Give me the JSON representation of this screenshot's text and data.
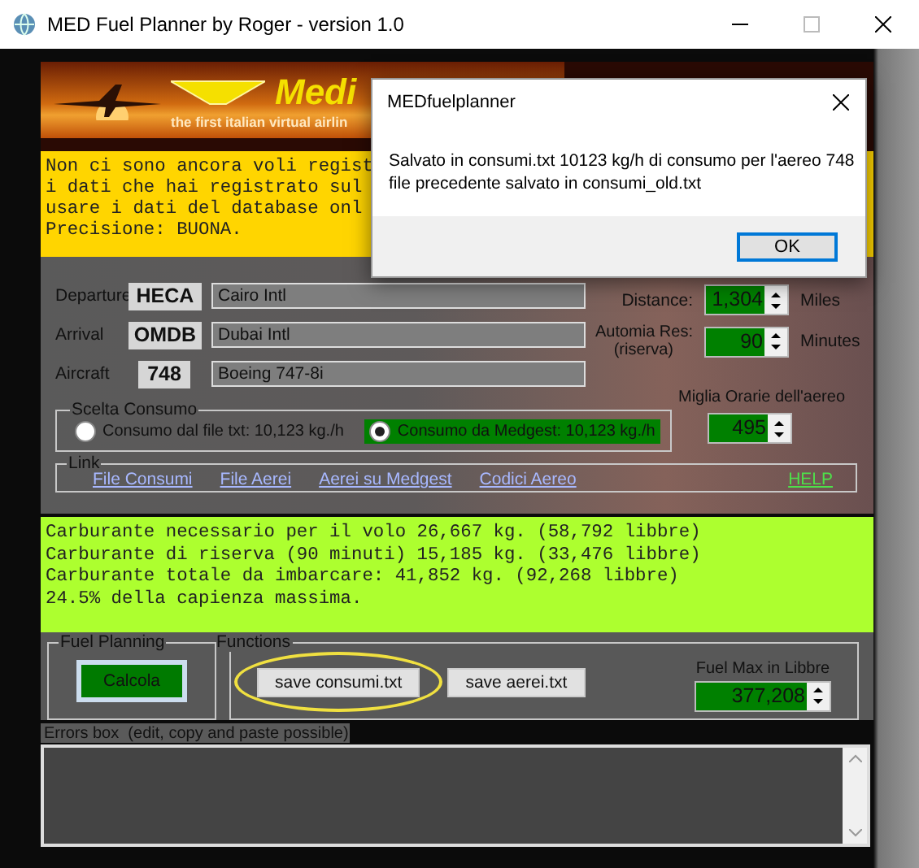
{
  "window": {
    "title": "MED Fuel Planner by Roger - version 1.0"
  },
  "banner": {
    "brand": "Medi",
    "tagline": "the first italian virtual airlin"
  },
  "notice": {
    "lines": [
      "Non ci sono ancora voli regist",
      "i dati che hai registrato sul",
      "usare i dati del database onl",
      "Precisione: BUONA."
    ]
  },
  "route": [
    {
      "label": "Departure",
      "code": "HECA",
      "name": "Cairo Intl"
    },
    {
      "label": "Arrival",
      "code": "OMDB",
      "name": "Dubai Intl"
    },
    {
      "label": "Aircraft",
      "code": "748",
      "name": "Boeing 747-8i"
    }
  ],
  "distance": {
    "label": "Distance:",
    "value": "1,304",
    "unit": "Miles"
  },
  "reserve": {
    "label": "Automia Res:",
    "sublabel": "(riserva)",
    "value": "90",
    "unit": "Minutes"
  },
  "speed": {
    "label": "Miglia Orarie dell'aereo",
    "value": "495"
  },
  "consumption": {
    "title": "Scelta Consumo",
    "options": [
      {
        "label": "Consumo dal file txt: 10,123 kg./h",
        "selected": false
      },
      {
        "label": "Consumo da Medgest: 10,123 kg./h",
        "selected": true
      }
    ]
  },
  "links": {
    "title": "Link",
    "items": [
      "File Consumi",
      "File Aerei",
      "Aerei su Medgest",
      "Codici Aereo"
    ],
    "help": "HELP"
  },
  "results": {
    "lines": [
      "Carburante necessario per il volo 26,667 kg. (58,792 libbre)",
      "Carburante di riserva (90 minuti) 15,185 kg. (33,476 libbre)",
      "Carburante totale da imbarcare: 41,852 kg. (92,268 libbre)",
      "24.5% della capienza massima."
    ]
  },
  "fuel_planning": {
    "title": "Fuel Planning",
    "button": "Calcola"
  },
  "functions": {
    "title": "Functions",
    "buttons": [
      {
        "label": "save consumi.txt",
        "highlighted": true
      },
      {
        "label": "save aerei.txt",
        "highlighted": false
      }
    ]
  },
  "fuel_max": {
    "label": "Fuel Max in Libbre",
    "value": "377,208"
  },
  "errors_box": {
    "label": "Errors box  (edit, copy and paste possible)"
  },
  "dialog": {
    "title": "MEDfuelplanner",
    "lines": [
      "Salvato in consumi.txt 10123 kg/h di consumo per l'aereo 748",
      "file precedente salvato in consumi_old.txt"
    ],
    "button": "OK"
  }
}
